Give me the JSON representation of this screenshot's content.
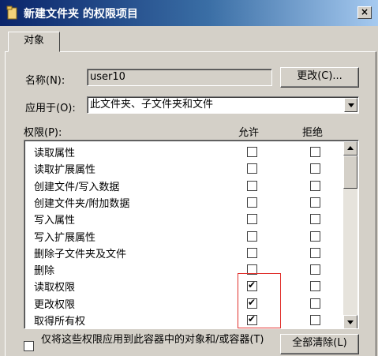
{
  "window": {
    "title": "新建文件夹 的权限项目",
    "close_label": "×"
  },
  "tabs": [
    {
      "label": "对象"
    }
  ],
  "name_row": {
    "label": "名称(N):",
    "value": "user10",
    "change_button": "更改(C)..."
  },
  "apply_row": {
    "label": "应用于(O):",
    "value": "此文件夹、子文件夹和文件"
  },
  "permissions": {
    "header_label": "权限(P):",
    "allow_header": "允许",
    "deny_header": "拒绝",
    "items": [
      {
        "label": "读取属性",
        "allow": false,
        "deny": false
      },
      {
        "label": "读取扩展属性",
        "allow": false,
        "deny": false
      },
      {
        "label": "创建文件/写入数据",
        "allow": false,
        "deny": false
      },
      {
        "label": "创建文件夹/附加数据",
        "allow": false,
        "deny": false
      },
      {
        "label": "写入属性",
        "allow": false,
        "deny": false
      },
      {
        "label": "写入扩展属性",
        "allow": false,
        "deny": false
      },
      {
        "label": "删除子文件夹及文件",
        "allow": false,
        "deny": false
      },
      {
        "label": "删除",
        "allow": false,
        "deny": false
      },
      {
        "label": "读取权限",
        "allow": true,
        "deny": false
      },
      {
        "label": "更改权限",
        "allow": true,
        "deny": false
      },
      {
        "label": "取得所有权",
        "allow": true,
        "deny": false
      }
    ]
  },
  "apply_only": {
    "label": "仅将这些权限应用到此容器中的对象和/或容器(T)",
    "checked": false
  },
  "clear_all_button": "全部清除(L)",
  "colors": {
    "title_gradient_start": "#0a246a",
    "highlight_box": "#e0302c"
  }
}
